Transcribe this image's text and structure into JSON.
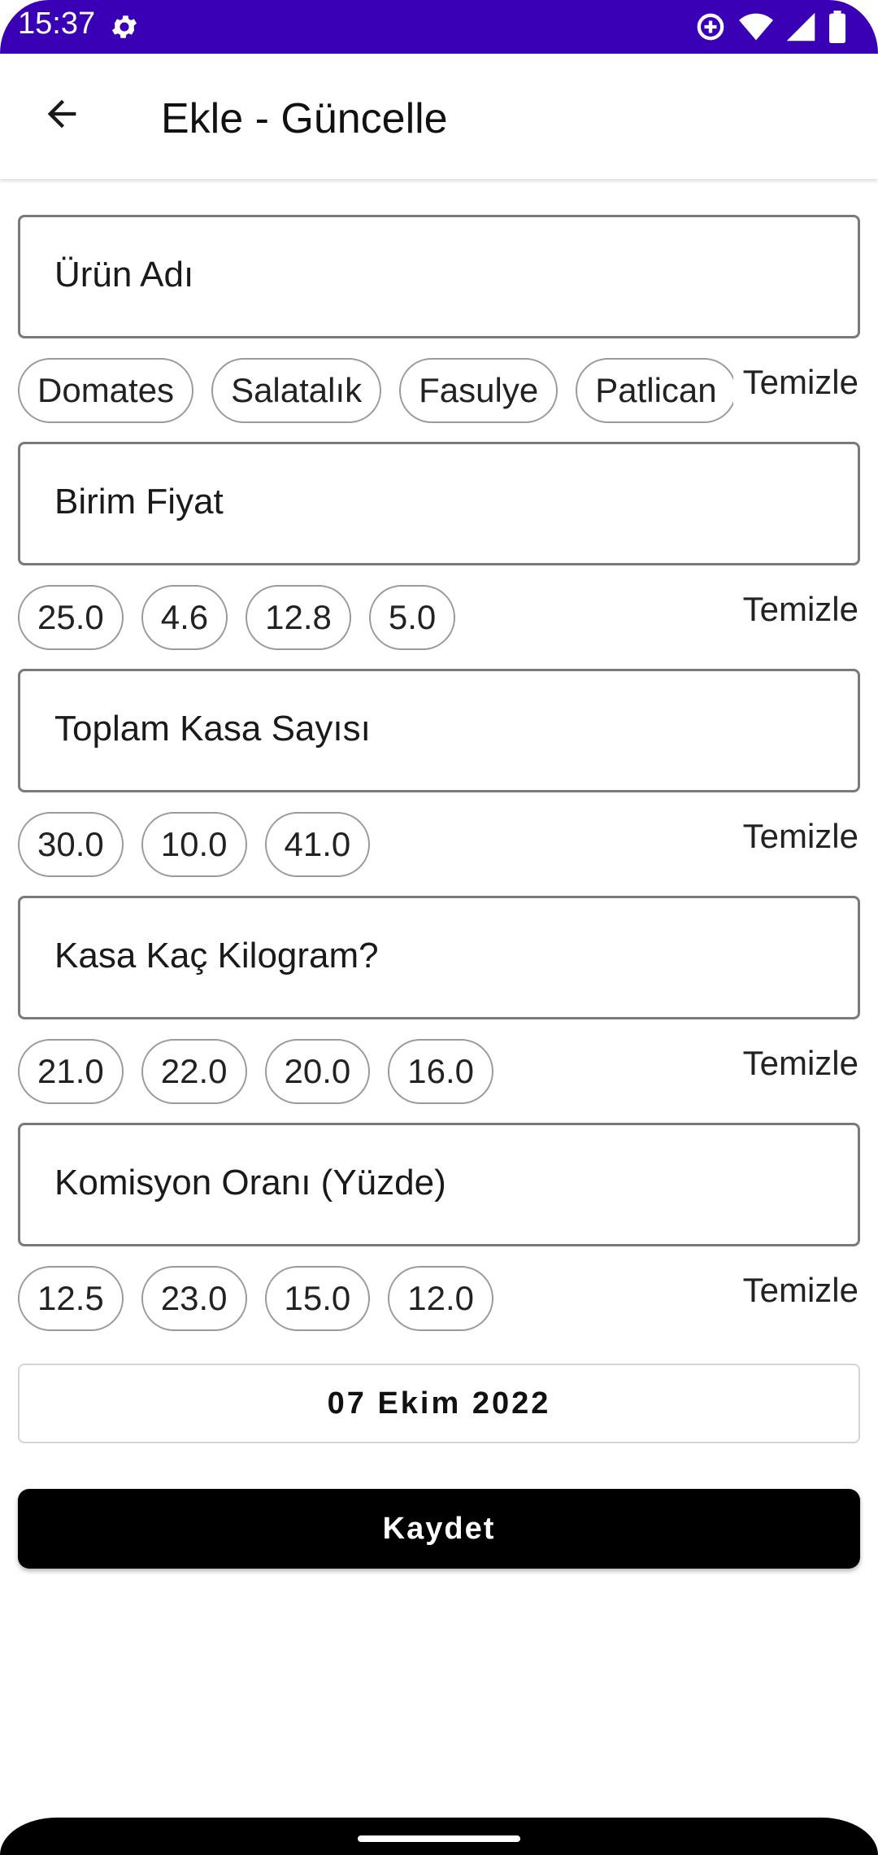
{
  "status_bar": {
    "time": "15:37",
    "icons": [
      "gear-icon",
      "data-saver-icon",
      "wifi-icon",
      "signal-icon",
      "battery-icon"
    ]
  },
  "app_bar": {
    "title": "Ekle - Güncelle",
    "back_icon": "arrow-left-icon"
  },
  "form": {
    "clear_label": "Temizle",
    "fields": [
      {
        "label": "Ürün Adı",
        "chips": [
          "Domates",
          "Salatalık",
          "Fasulye",
          "Patlican"
        ]
      },
      {
        "label": "Birim Fiyat",
        "chips": [
          "25.0",
          "4.6",
          "12.8",
          "5.0"
        ]
      },
      {
        "label": "Toplam Kasa Sayısı",
        "chips": [
          "30.0",
          "10.0",
          "41.0"
        ]
      },
      {
        "label": "Kasa Kaç Kilogram?",
        "chips": [
          "21.0",
          "22.0",
          "20.0",
          "16.0"
        ]
      },
      {
        "label": "Komisyon Oranı (Yüzde)",
        "chips": [
          "12.5",
          "23.0",
          "15.0",
          "12.0"
        ]
      }
    ],
    "date_label": "07 Ekim 2022",
    "save_label": "Kaydet"
  },
  "colors": {
    "status_bar": "#3a00b6",
    "primary_button": "#000000"
  }
}
